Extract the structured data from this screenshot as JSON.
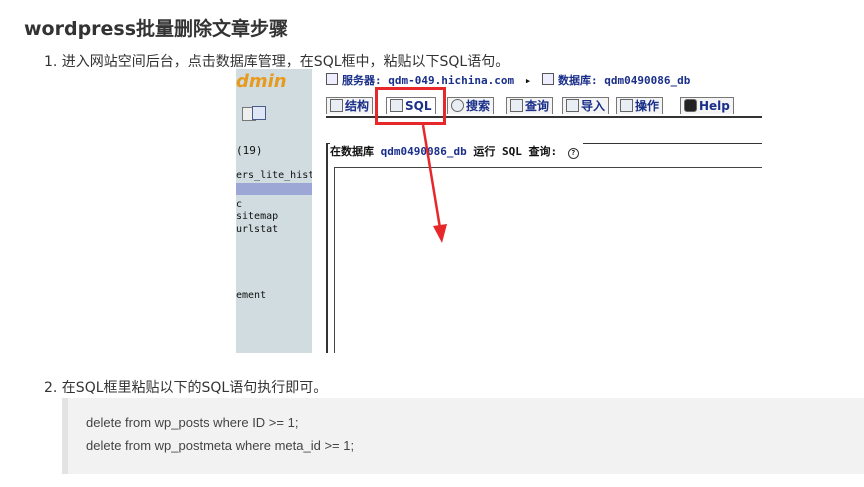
{
  "article": {
    "title": "wordpress批量删除文章步骤",
    "step1": "1. 进入网站空间后台，点击数据库管理，在SQL框中，粘贴以下SQL语句。",
    "step2": "2. 在SQL框里粘贴以下的SQL语句执行即可。"
  },
  "screenshot": {
    "sidebar": {
      "logo_text": "dmin",
      "db_count": "(19)",
      "tables": [
        "ers_lite_histo",
        "c",
        "sitemap",
        "urlstat",
        "ement"
      ]
    },
    "topbar": {
      "server_label": "服务器:",
      "server_value": "qdm-049.hichina.com",
      "arrow": "▸",
      "db_label": "数据库:",
      "db_value": "qdm0490086_db"
    },
    "tabs": [
      {
        "label": "结构",
        "icon": "structure-icon"
      },
      {
        "label": "SQL",
        "icon": "sql-icon"
      },
      {
        "label": "搜索",
        "icon": "search-icon"
      },
      {
        "label": "查询",
        "icon": "query-icon"
      },
      {
        "label": "导入",
        "icon": "import-icon"
      },
      {
        "label": "操作",
        "icon": "operations-icon"
      },
      {
        "label": "Help",
        "icon": "help-icon"
      }
    ],
    "query_label_prefix": "在数据库",
    "query_label_db": "qdm0490086_db",
    "query_label_suffix": "运行 SQL 查询:",
    "help_symbol": "?"
  },
  "code": {
    "line1": "delete from wp_posts where ID >= 1;",
    "line2": "delete from wp_postmeta where meta_id >= 1;"
  },
  "colors": {
    "highlight_red": "#e6282a",
    "sidebar_bg": "#d0dce0",
    "link_blue": "#1a2f8a"
  }
}
